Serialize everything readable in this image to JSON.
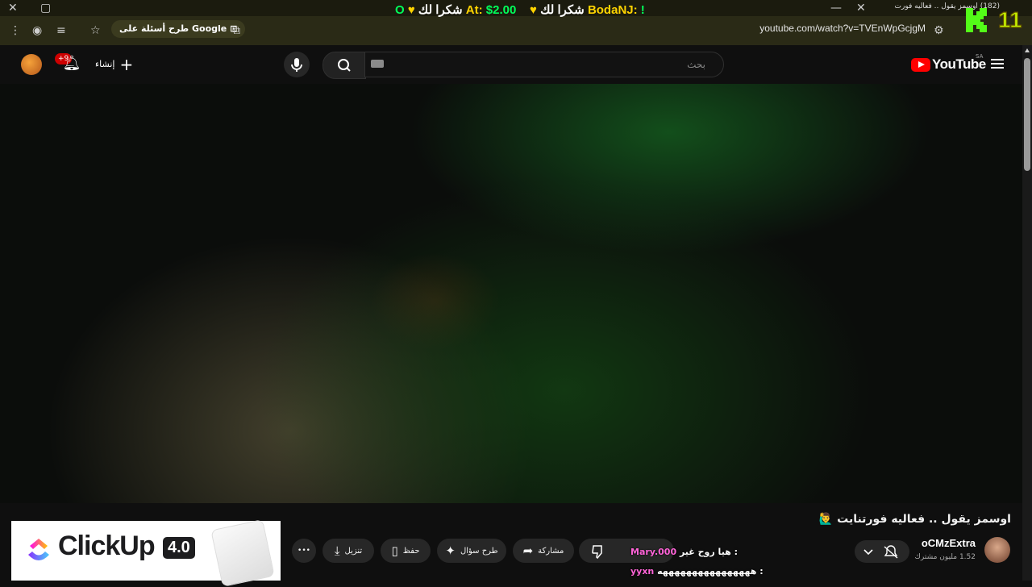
{
  "browser": {
    "tab_title": "(182) اوسمز يقول .. فعاليه فورت",
    "google_pill": "طرح أسئلة على Google",
    "url": "youtube.com/watch?v=TVEnWpGcjgM"
  },
  "overlay": {
    "ticker": {
      "part1": "O",
      "part2": "شكرا لك",
      "part3": "At:",
      "part4": "$2.00",
      "part5": "شكرا لك",
      "part6": "BodaNJ:",
      "part7": "!"
    },
    "chat": [
      {
        "name": "Mary.000",
        "text": "هيا روح غير :"
      },
      {
        "name": "yyxn",
        "text": "ههههههههههههههههه :"
      }
    ],
    "brand_text": "11"
  },
  "masthead": {
    "logo_text": "YouTube",
    "country_code": "SA",
    "search_placeholder": "بحث",
    "create_label": "إنشاء",
    "notif_badge": "+9"
  },
  "video": {
    "title": "اوسمز يقول .. فعاليه فورتنايت 🙋‍♂️",
    "channel": "oCMzExtra",
    "subscribers": "1.52 مليون مشترك"
  },
  "actions": {
    "dislike_partial": "",
    "share": "مشاركة",
    "ask": "طرح سؤال",
    "save": "حفظ",
    "download": "تنزيل",
    "more": "•••"
  },
  "ad": {
    "brand": "ClickUp",
    "version": "4.0"
  },
  "colors": {
    "accent": "#ff0000",
    "ticker_yellow": "#ffd400",
    "ticker_green": "#00ff5a",
    "chat_nick": "#ff64d8"
  }
}
